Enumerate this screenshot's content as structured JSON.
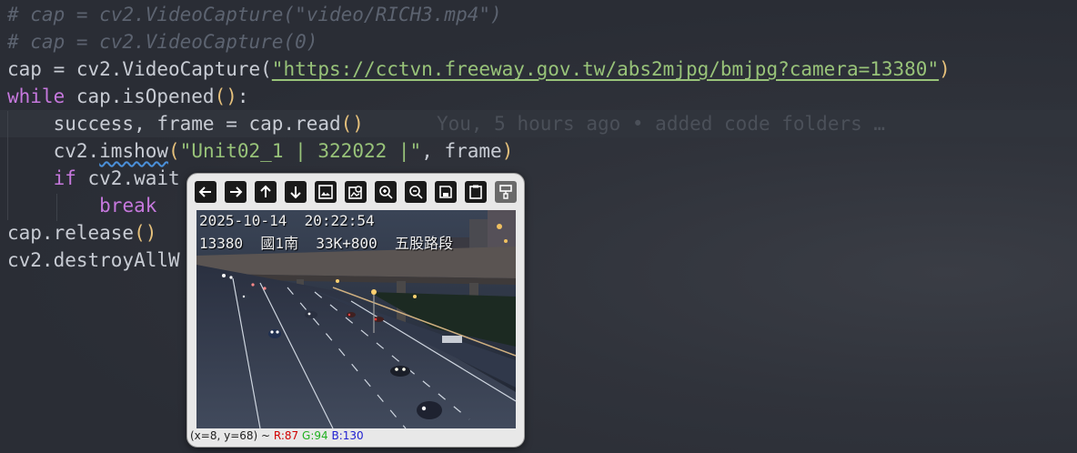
{
  "code": {
    "line1_comment": "# cap = cv2.VideoCapture(\"video/RICH3.mp4\")",
    "line2_comment": "# cap = cv2.VideoCapture(0)",
    "line3_prefix": "cap = cv2.VideoCapture(",
    "line3_url": "\"https://cctvn.freeway.gov.tw/abs2mjpg/bmjpg?camera=13380\"",
    "line3_suffix": ")",
    "line4_kw": "while",
    "line4_rest": " cap.isOpened",
    "line4_tail": ":",
    "line5_text": "    success, frame = cap.read",
    "line5_blame": "You, 5 hours ago • added code folders …",
    "line6_prefix": "    cv2.",
    "line6_fn": "imshow",
    "line6_str": "\"Unit02_1 | 322022 |\"",
    "line6_rest": ", frame",
    "line7_kw": "if",
    "line7_rest": " cv2.wait",
    "line8_kw": "break",
    "line9_text": "cap.release",
    "line10_text": "cv2.destroyAllW"
  },
  "image_window": {
    "toolbar": [
      "arrow-left-icon",
      "arrow-right-icon",
      "arrow-up-icon",
      "arrow-down-icon",
      "image-icon",
      "image-search-icon",
      "zoom-in-icon",
      "zoom-out-icon",
      "save-icon",
      "clipboard-icon",
      "paint-roller-icon"
    ],
    "osd_line1": "2025-10-14  20:22:54",
    "osd_line2": "13380  國1南  33K+800  五股路段",
    "status_coords": "(x=8, y=68) ~ ",
    "status_r": "R:87",
    "status_g": "G:94",
    "status_b": "B:130",
    "colors": {
      "r": "#d00000",
      "g": "#20b020",
      "b": "#2020d0"
    }
  }
}
